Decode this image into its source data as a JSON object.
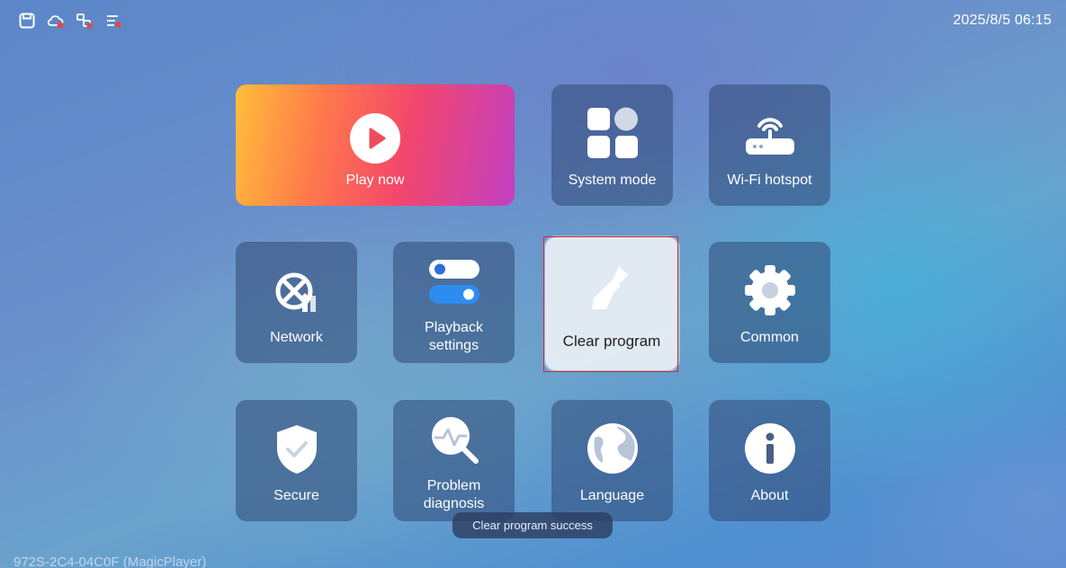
{
  "status_bar": {
    "icons": [
      "save-icon",
      "cloud-disconnected-icon",
      "sync-error-icon",
      "list-error-icon"
    ],
    "clock": "2025/8/5 06:15"
  },
  "tiles": {
    "play_now": "Play now",
    "system_mode": "System mode",
    "wifi_hotspot": "Wi-Fi hotspot",
    "network": "Network",
    "playback_settings": "Playback settings",
    "clear_program": "Clear program",
    "common": "Common",
    "secure": "Secure",
    "problem_diagnosis": "Problem diagnosis",
    "language": "Language",
    "about": "About"
  },
  "toast": "Clear program success",
  "device_id": "972S-2C4-04C0F (MagicPlayer)",
  "colors": {
    "focus_outline": "#d52b2b",
    "tile_bg": "#30487680",
    "play_gradient": [
      "#ffbe3b",
      "#f4476b",
      "#c13fc2"
    ]
  }
}
